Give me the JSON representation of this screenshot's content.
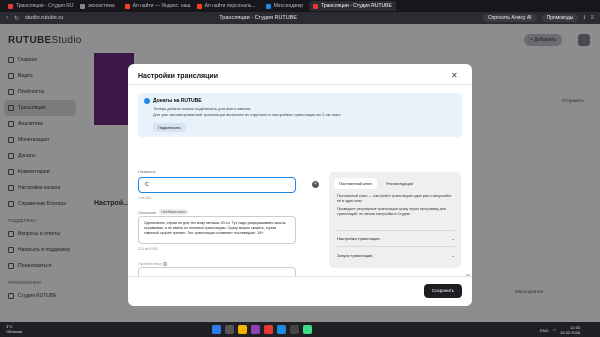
{
  "browser": {
    "tabs": [
      {
        "label": "Трансляции - Студия RUTUBE",
        "fav_color": "#e53935",
        "active": false
      },
      {
        "label": "экосистема",
        "fav_color": "#888888",
        "active": false
      },
      {
        "label": "Ап найти — Яндекс: нашлось",
        "fav_color": "#fc3f1d",
        "active": false
      },
      {
        "label": "Ап найти персональ...",
        "fav_color": "#fc3f1d",
        "active": false
      },
      {
        "label": "Мессенджер",
        "fav_color": "#1e88e5",
        "active": false
      },
      {
        "label": "Трансляции - Студия RUTUBE",
        "fav_color": "#e53935",
        "active": true
      }
    ],
    "url": "studio.rutube.ru",
    "title": "Трансляции - Студия RUTUBE",
    "ask_label": "Спросить Алису AI",
    "promo_label": "Промокоды"
  },
  "app": {
    "logo_main": "RUTUBE",
    "logo_sub": "Studio",
    "add_button": "+ Добавить"
  },
  "sidebar": {
    "items": [
      {
        "label": "Главная",
        "active": false
      },
      {
        "label": "Видео",
        "active": false
      },
      {
        "label": "Плейлисты",
        "active": false
      },
      {
        "label": "Трансляции",
        "active": true
      },
      {
        "label": "Аналитика",
        "active": false
      },
      {
        "label": "Монетизация",
        "active": false
      },
      {
        "label": "Донаты",
        "active": false
      },
      {
        "label": "Комментарии",
        "active": false
      },
      {
        "label": "Настройки канала",
        "active": false
      },
      {
        "label": "Справочник Блогера",
        "active": false
      }
    ],
    "support_section": "ПОДДЕРЖКА",
    "support_items": [
      {
        "label": "Вопросы и ответы"
      },
      {
        "label": "Написать в поддержку"
      },
      {
        "label": "Пожаловаться"
      }
    ],
    "apps_section": "ПРИЛОЖЕНИЯ",
    "apps_items": [
      {
        "label": "Студия RUTUBE"
      }
    ]
  },
  "background": {
    "settings_title": "Настрой...",
    "right_comment": "Отправить",
    "right_footer": "Мероприятия"
  },
  "modal": {
    "title": "Настройки трансляции",
    "close": "✕",
    "banner": {
      "title": "Донаты на RUTUBE",
      "line1": "Теперь донаты можно подключить для всего канала.",
      "line2": "Для уже запланированной трансляции включите их отдельно в настройках трансляции во 2-ом шаге",
      "button": "Подключить"
    },
    "name_label": "Название",
    "name_value": "С",
    "name_counter": "1 из 100",
    "desc_label": "Описание",
    "desc_tag": "Необязательно",
    "desc_value": "Однозначно, стрим не для тех кому меньше 20-ти. Тут надо разукрашивать мысль отрывками, а не иметь по печенью трансляцию. Сразу можно сказать, стрим тяжелый скорее трекинг. Это трансляция оставляет послевкусие. 18+",
    "desc_counter": "213 из 5 000",
    "welcome_label": "Приветствие",
    "key_panel": {
      "tab1": "Постоянный ключ",
      "tab2": "Рекомендации",
      "text1": "Постоянный ключ — настройте трансляцию один раз и запускайте её в один клик",
      "text2": "Проведите регулярные трансляции сразу через программу для трансляций, не меняя настройки в Студии",
      "row1": "Настройка трансляции",
      "row2": "Запуск трансляции"
    },
    "save_button": "Сохранить"
  },
  "taskbar": {
    "weather_temp": "3°C",
    "weather_desc": "Облачно",
    "lang": "ENG",
    "time": "12:03",
    "date": "15.02.2026"
  }
}
